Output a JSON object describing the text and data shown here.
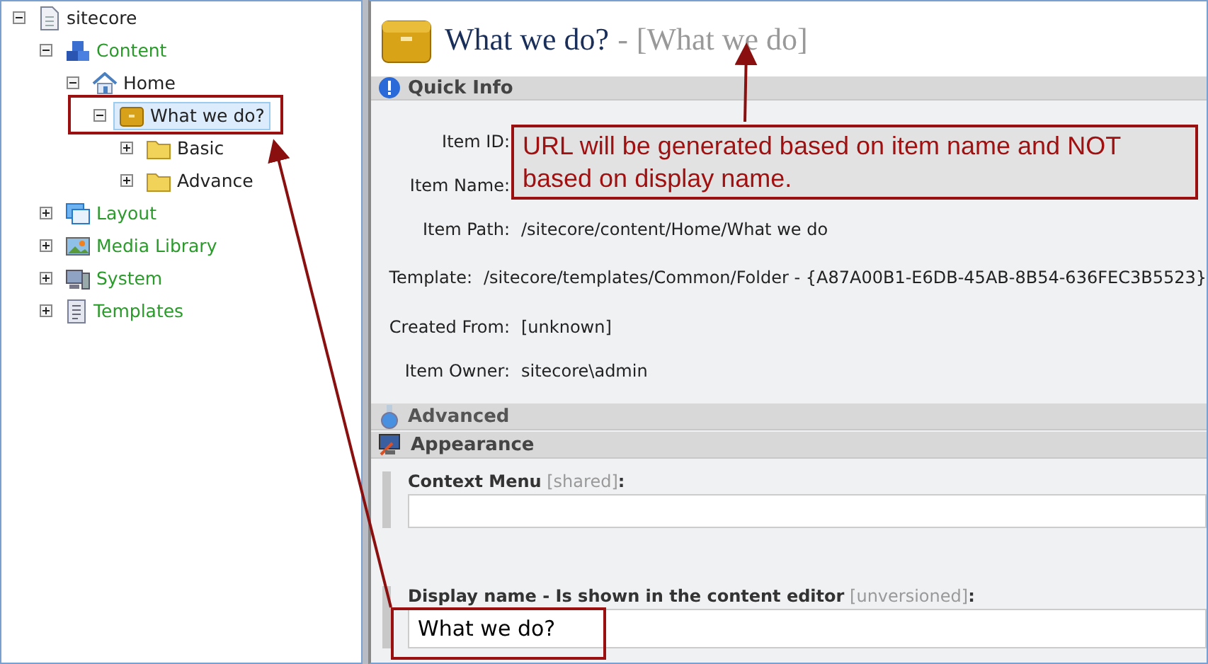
{
  "tree": [
    {
      "label": "sitecore",
      "kind": "document",
      "color": "#222222",
      "expanded": true,
      "selected": false,
      "children": [
        {
          "label": "Content",
          "kind": "content",
          "color": "#2a9a2a",
          "expanded": true,
          "selected": false,
          "children": [
            {
              "label": "Home",
              "kind": "home",
              "color": "#222222",
              "expanded": true,
              "selected": false,
              "children": [
                {
                  "label": "What we do?",
                  "kind": "item",
                  "color": "#222222",
                  "expanded": true,
                  "selected": true,
                  "children": [
                    {
                      "label": "Basic",
                      "kind": "folder",
                      "color": "#222222",
                      "expanded": false,
                      "selected": false
                    },
                    {
                      "label": "Advance",
                      "kind": "folder",
                      "color": "#222222",
                      "expanded": false,
                      "selected": false
                    }
                  ]
                }
              ]
            }
          ]
        },
        {
          "label": "Layout",
          "kind": "layout",
          "color": "#2a9a2a",
          "expanded": false,
          "selected": false
        },
        {
          "label": "Media Library",
          "kind": "media",
          "color": "#2a9a2a",
          "expanded": false,
          "selected": false
        },
        {
          "label": "System",
          "kind": "system",
          "color": "#2a9a2a",
          "expanded": false,
          "selected": false
        },
        {
          "label": "Templates",
          "kind": "templates",
          "color": "#2a9a2a",
          "expanded": false,
          "selected": false
        }
      ]
    }
  ],
  "header": {
    "title": "What we do?",
    "separator": "-",
    "display_name": "[What we do]"
  },
  "sections": [
    {
      "title": "Quick Info",
      "kind": "info",
      "expanded": true,
      "rows": [
        {
          "label": "Item ID:"
        },
        {
          "label": "Item Name:"
        },
        {
          "label": "Item Path:",
          "value": "/sitecore/content/Home/What we do"
        },
        {
          "label": "Template:",
          "value": "/sitecore/templates/Common/Folder -  {A87A00B1-E6DB-45AB-8B54-636FEC3B5523}"
        },
        {
          "label": "Created From:",
          "value": "[unknown]"
        },
        {
          "label": "Item Owner:",
          "value": "sitecore\\admin"
        }
      ]
    },
    {
      "title": "Advanced",
      "kind": "flask",
      "expanded": false
    },
    {
      "title": "Appearance",
      "kind": "monitor",
      "expanded": true,
      "fields": [
        {
          "label": "Context Menu",
          "scope": "[shared]",
          "colon": ":"
        },
        {
          "label": "Display name - Is shown in the content editor",
          "scope": "[unversioned]",
          "colon": ":",
          "value": "What we do?"
        }
      ]
    }
  ],
  "callout": {
    "text": "URL will be generated based on item name and NOT based on display name."
  }
}
